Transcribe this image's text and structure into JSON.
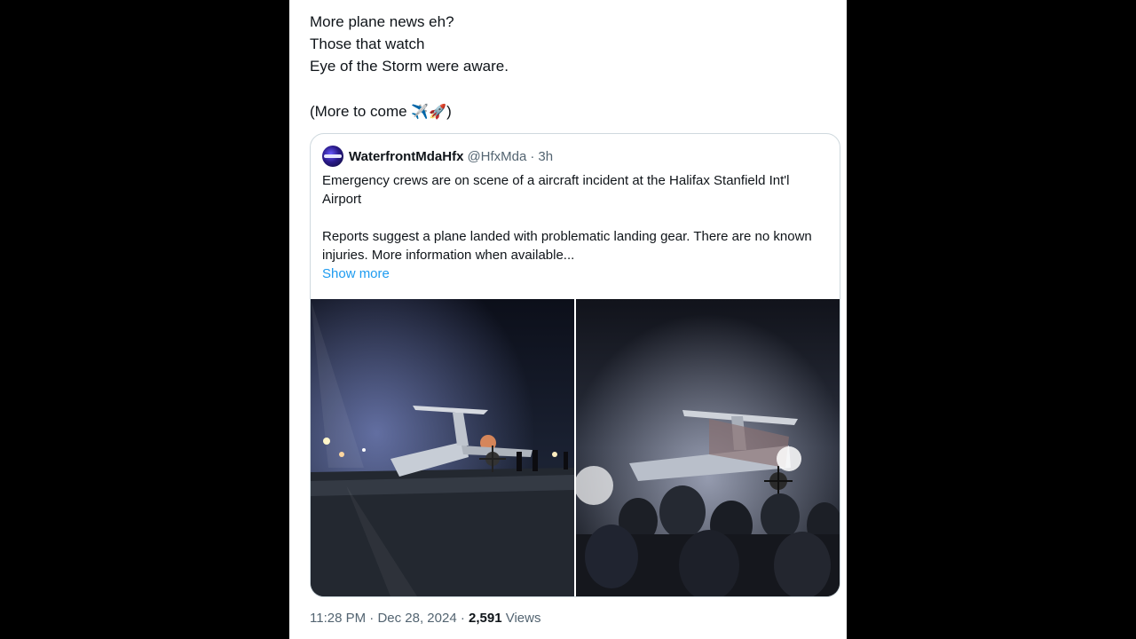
{
  "tweet": {
    "lines": [
      "More plane news eh?",
      "Those that watch",
      "Eye of the Storm were aware."
    ],
    "closing_prefix": "(More to come ",
    "closing_emoji": "✈️🚀",
    "closing_suffix": ")"
  },
  "quoted": {
    "display_name": "WaterfrontMdaHfx",
    "handle": "@HfxMda",
    "separator": "·",
    "time": "3h",
    "paragraph1": "Emergency crews are on scene of a aircraft incident at the Halifax Stanfield Int'l Airport",
    "paragraph2": "Reports suggest a plane landed with problematic landing gear. There are no known injuries. More information when available...",
    "show_more": "Show more",
    "avatar_icon": "news-logo-icon"
  },
  "footer": {
    "time": "11:28 PM",
    "sep1": "·",
    "date": "Dec 28, 2024",
    "sep2": "·",
    "views_count": "2,591",
    "views_label": "Views"
  },
  "colors": {
    "background": "#000000",
    "card": "#ffffff",
    "text": "#0f1419",
    "muted": "#536471",
    "link": "#1d9bf0",
    "border": "#cfd9de"
  }
}
